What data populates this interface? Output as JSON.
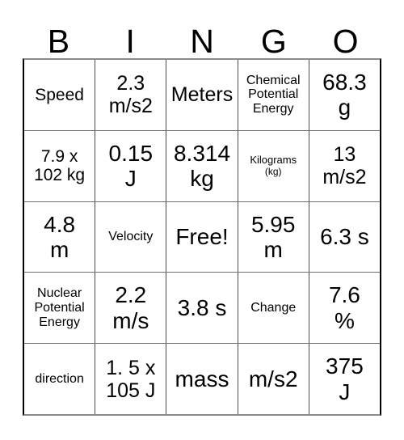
{
  "card": {
    "title": "BINGO Card",
    "header_letters": [
      "B",
      "I",
      "N",
      "G",
      "O"
    ],
    "columns": 5,
    "rows": 5,
    "free_space": "Free!",
    "colors": {
      "background": "#ffffff",
      "text": "#000000",
      "outer_border": "#000000",
      "inner_border": "#4a4a4a"
    },
    "cells": [
      [
        {
          "text": "Speed",
          "size": "md"
        },
        {
          "text": "2.3\nm/s2",
          "size": "lg"
        },
        {
          "text": "Meters",
          "size": "lg"
        },
        {
          "text": "Chemical\nPotential\nEnergy",
          "size": "sm"
        },
        {
          "text": "68.3\ng",
          "size": "xl"
        }
      ],
      [
        {
          "text": "7.9 x\n102 kg",
          "size": "md"
        },
        {
          "text": "0.15\nJ",
          "size": "xl"
        },
        {
          "text": "8.314\nkg",
          "size": "xl"
        },
        {
          "text": "Kilograms",
          "size": "xs",
          "sub": "(kg)"
        },
        {
          "text": "13\nm/s2",
          "size": "lg"
        }
      ],
      [
        {
          "text": "4.8\nm",
          "size": "xl"
        },
        {
          "text": "Velocity",
          "size": "sm"
        },
        {
          "text": "Free!",
          "size": "xl"
        },
        {
          "text": "5.95\nm",
          "size": "xl"
        },
        {
          "text": "6.3 s",
          "size": "xl"
        }
      ],
      [
        {
          "text": "Nuclear\nPotential\nEnergy",
          "size": "sm"
        },
        {
          "text": "2.2\nm/s",
          "size": "xl"
        },
        {
          "text": "3.8 s",
          "size": "xl"
        },
        {
          "text": "Change",
          "size": "sm"
        },
        {
          "text": "7.6\n%",
          "size": "xl"
        }
      ],
      [
        {
          "text": "direction",
          "size": "sm"
        },
        {
          "text": "1. 5 x\n105 J",
          "size": "lg"
        },
        {
          "text": "mass",
          "size": "xl"
        },
        {
          "text": "m/s2",
          "size": "xl"
        },
        {
          "text": "375\nJ",
          "size": "xl"
        }
      ]
    ]
  }
}
